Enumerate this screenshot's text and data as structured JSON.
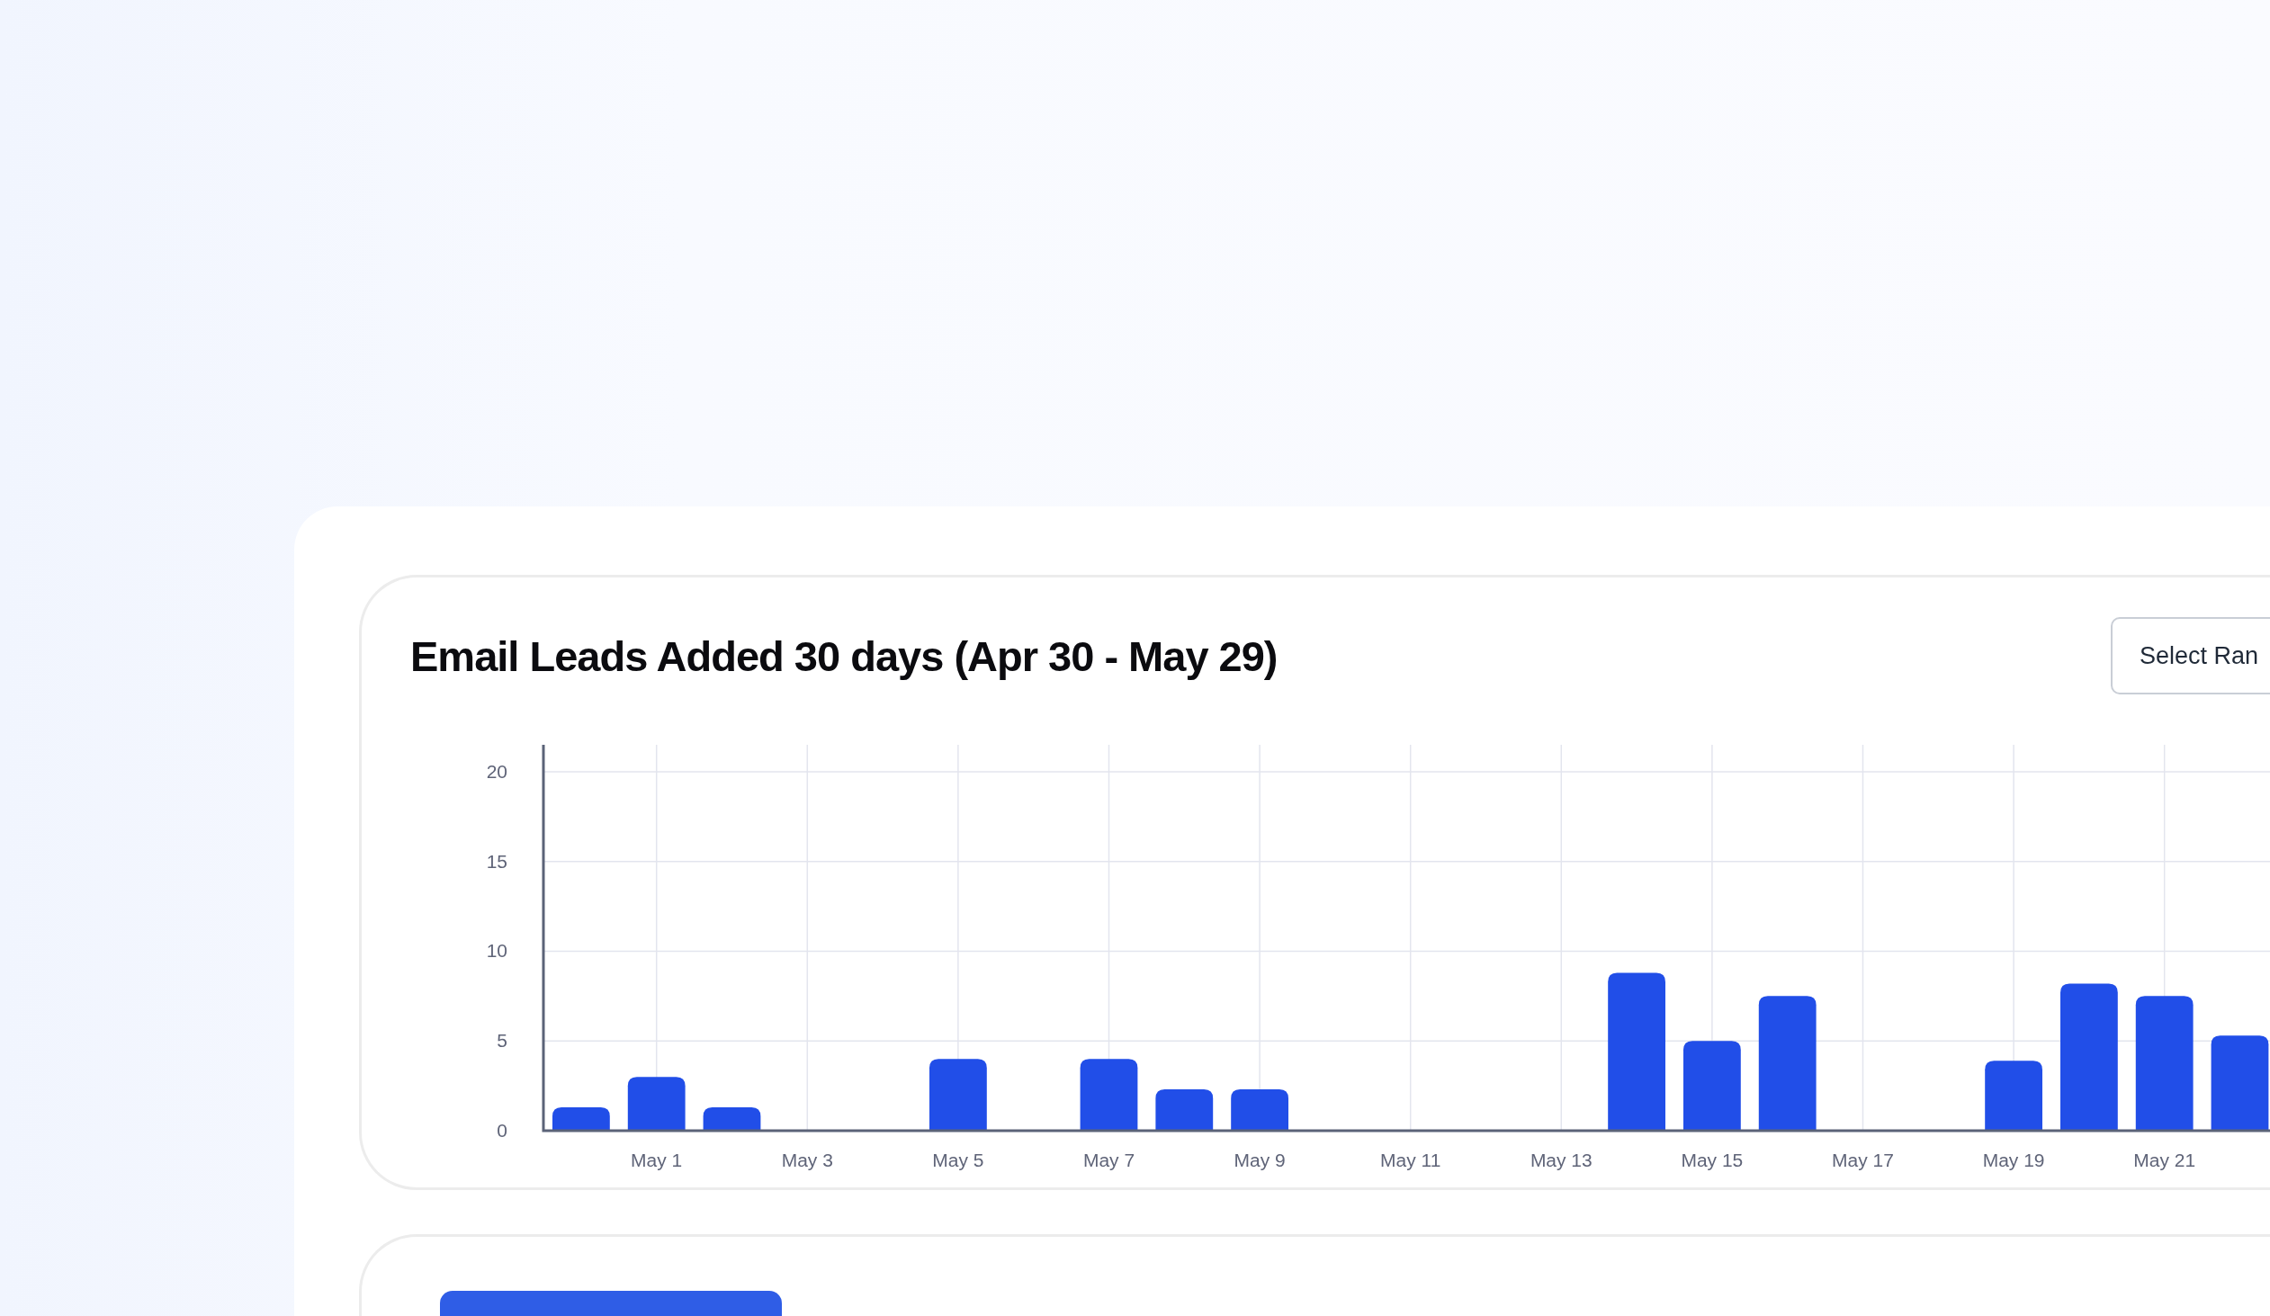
{
  "chart_card": {
    "title": "Email Leads Added 30 days (Apr 30 - May 29)",
    "range_button": "Select Ran",
    "chart_data": {
      "type": "bar",
      "ylim": [
        0,
        20
      ],
      "yticks": [
        0,
        5,
        10,
        15,
        20
      ],
      "grid": true,
      "categories": [
        null,
        "May 1",
        null,
        "May 3",
        null,
        "May 5",
        null,
        "May 7",
        null,
        "May 9",
        null,
        "May 11",
        null,
        "May 13",
        null,
        "May 15",
        null,
        "May 17",
        null,
        "May 19",
        null,
        "May 21",
        null
      ],
      "series": [
        {
          "color": "#214ee8",
          "values": [
            1.3,
            3,
            1.3,
            0,
            0,
            4,
            0,
            4,
            2.3,
            2.3,
            0,
            0,
            0,
            0,
            8.8,
            5,
            7.5,
            0,
            0,
            3.9,
            8.2,
            7.5,
            5.3
          ]
        }
      ]
    }
  },
  "second_card": {
    "kind": "button"
  }
}
